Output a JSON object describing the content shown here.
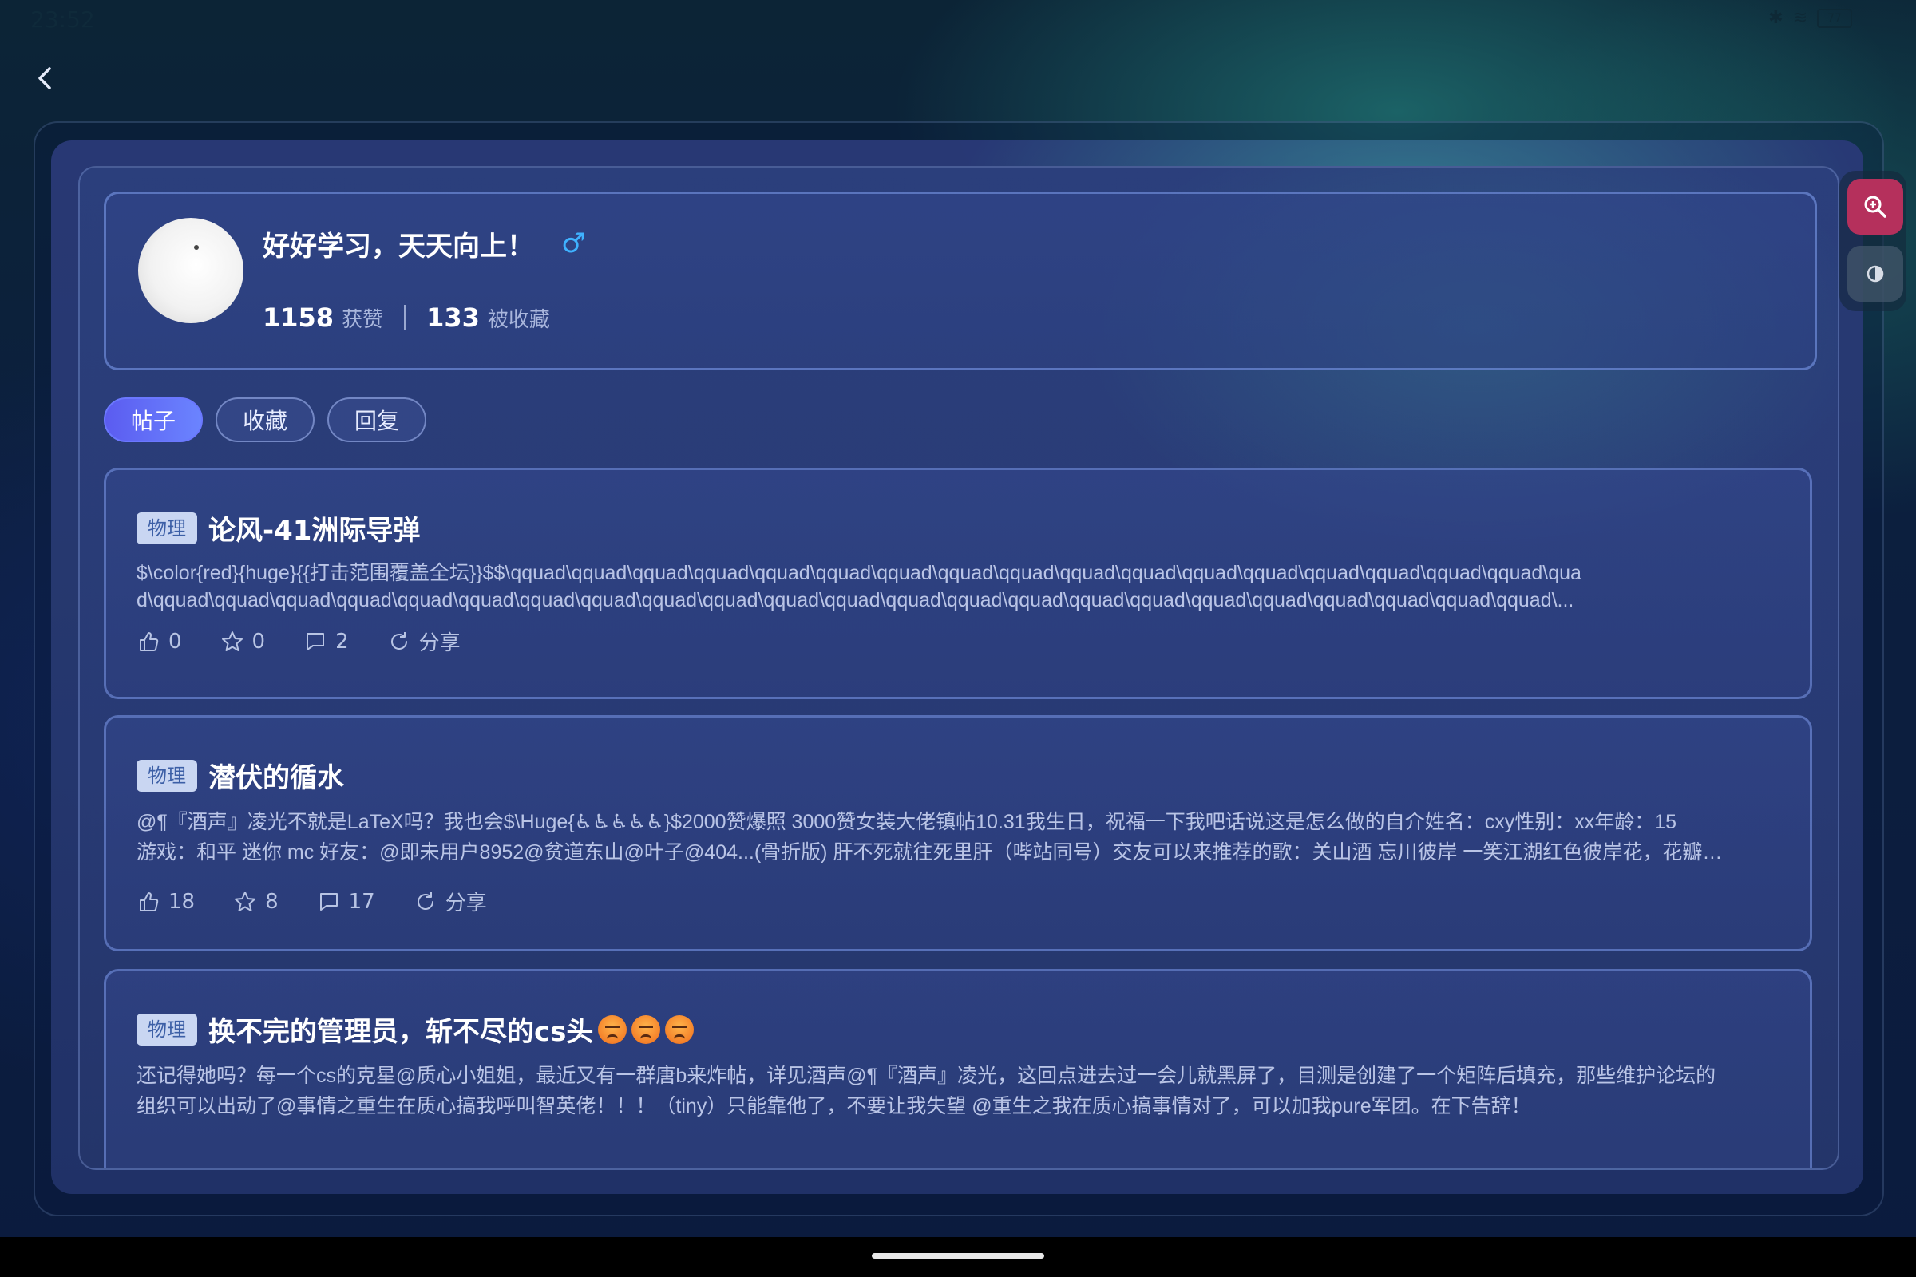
{
  "status": {
    "time": "23:52",
    "battery": "77"
  },
  "profile": {
    "username": "好好学习，天天向上！",
    "gender_symbol": "♂",
    "likes_count": "1158",
    "likes_label": "获赞",
    "favorited_count": "133",
    "favorited_label": "被收藏"
  },
  "tabs": [
    {
      "label": "帖子",
      "active": true
    },
    {
      "label": "收藏",
      "active": false
    },
    {
      "label": "回复",
      "active": false
    }
  ],
  "posts": [
    {
      "tag": "物理",
      "title": "论风-41洲际导弹",
      "lines": [
        "$\\color{red}{huge}{{打击范围覆盖全坛}}$$\\qquad\\qquad\\qquad\\qquad\\qquad\\qquad\\qquad\\qquad\\qquad\\qquad\\qquad\\qquad\\qquad\\qquad\\qquad\\qquad\\qquad\\qua",
        "d\\qquad\\qquad\\qquad\\qquad\\qquad\\qquad\\qquad\\qquad\\qquad\\qquad\\qquad\\qquad\\qquad\\qquad\\qquad\\qquad\\qquad\\qquad\\qquad\\qquad\\qquad\\qquad\\qquad\\..."
      ],
      "likes": "0",
      "stars": "0",
      "comments": "2",
      "share": "分享"
    },
    {
      "tag": "物理",
      "title": "潜伏的循水",
      "lines": [
        "@¶『酒声』凌光不就是LaTeX吗？我也会$\\Huge{♿♿♿♿♿}$2000赞爆照 3000赞女装大佬镇帖10.31我生日，祝福一下我吧话说这是怎么做的自介姓名：cxy性别：xx年龄：15",
        "游戏：和平 迷你 mc 好友：@即未用户8952@贫道东山@叶子@404...(骨折版) 肝不死就往死里肝（哔站同号）交友可以来推荐的歌：关山酒 忘川彼岸 一笑江湖红色彼岸花，花瓣…"
      ],
      "likes": "18",
      "stars": "8",
      "comments": "17",
      "share": "分享"
    },
    {
      "tag": "物理",
      "title": "换不完的管理员，斩不尽的cs头",
      "lines": [
        "还记得她吗？每一个cs的克星@质心小姐姐，最近又有一群唐b来炸帖，详见酒声@¶『酒声』凌光，这回点进去过一会儿就黑屏了，目测是创建了一个矩阵后填充，那些维护论坛的",
        "组织可以出动了@事情之重生在质心搞我呼叫智英佬！！！（tiny）只能靠他了，不要让我失望 @重生之我在质心搞事情对了，可以加我pure军团。在下告辞！"
      ]
    }
  ],
  "colors": {
    "accent": "#5b5cf0",
    "zoom_button": "#b5305c",
    "gender": "#3fb2ff"
  }
}
